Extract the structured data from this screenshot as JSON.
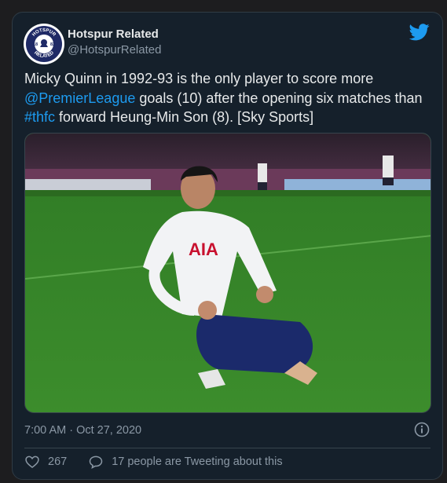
{
  "account": {
    "display_name": "Hotspur Related",
    "handle": "@HotspurRelated",
    "avatar_text": {
      "top": "HOTSPUR",
      "bottom": "RELATED",
      "left_num": "18",
      "right_num": "82"
    }
  },
  "tweet": {
    "text_part1": "Micky Quinn in 1992-93 is the only player to score more ",
    "mention": "@PremierLeague",
    "text_part2": " goals (10) after the opening six matches than ",
    "hashtag": "#thfc",
    "text_part3": " forward Heung-Min Son (8). [Sky Sports]",
    "timestamp": "7:00 AM · Oct 27, 2020"
  },
  "media": {
    "shirt_sponsor": "AIA",
    "icon": "photo-football-celebration"
  },
  "actions": {
    "likes": "267",
    "replies_label": "17 people are Tweeting about this"
  },
  "colors": {
    "background": "#15202b",
    "accent": "#1d9bf0",
    "text": "#e7e9ea",
    "muted": "#8b98a5"
  }
}
